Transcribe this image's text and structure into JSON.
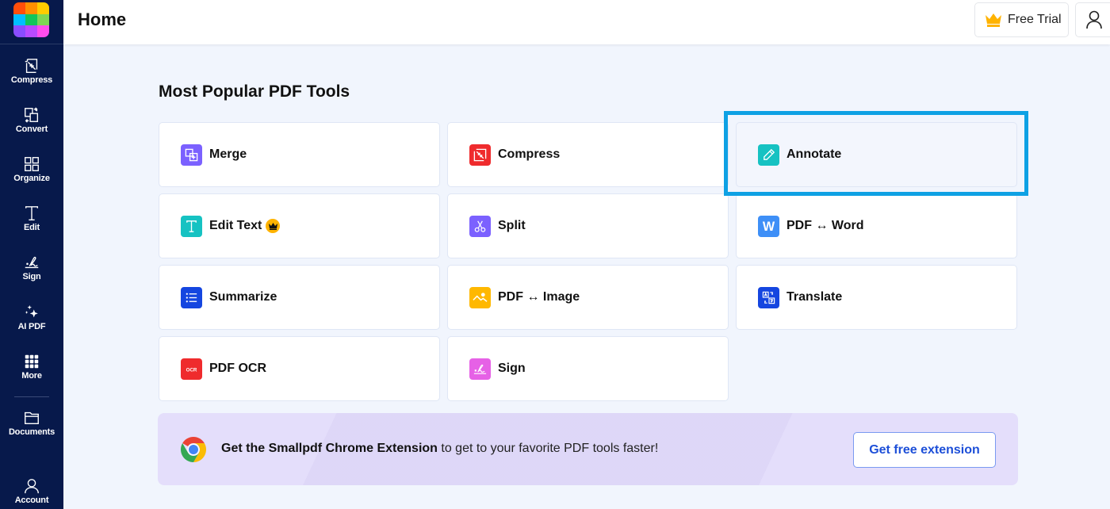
{
  "app": {
    "logo_colors": [
      "#ff4e0a",
      "#ff8f00",
      "#ffcc00",
      "#00bfff",
      "#12c65a",
      "#7fd655",
      "#8a4dff",
      "#b94bff",
      "#ff4ded"
    ]
  },
  "sidebar": {
    "items": [
      {
        "label": "Compress",
        "icon": "compress-icon"
      },
      {
        "label": "Convert",
        "icon": "convert-icon"
      },
      {
        "label": "Organize",
        "icon": "organize-icon"
      },
      {
        "label": "Edit",
        "icon": "edit-text-icon"
      },
      {
        "label": "Sign",
        "icon": "signature-icon"
      },
      {
        "label": "AI PDF",
        "icon": "sparkle-icon"
      },
      {
        "label": "More",
        "icon": "grid-dots-icon"
      },
      {
        "label": "Documents",
        "icon": "folder-icon"
      },
      {
        "label": "Account",
        "icon": "user-icon"
      }
    ]
  },
  "header": {
    "title": "Home",
    "free_trial_label": "Free Trial",
    "accent_color": "#ffb300"
  },
  "main": {
    "section_title": "Most Popular PDF Tools",
    "highlighted_tool": "Annotate",
    "highlight_color": "#0ea1e4",
    "tools": [
      {
        "label": "Merge",
        "icon": "merge-icon",
        "color": "#7b61ff",
        "premium": false
      },
      {
        "label": "Compress",
        "icon": "compress-icon",
        "color": "#ef2b2d",
        "premium": false
      },
      {
        "label": "Annotate",
        "icon": "pencil-icon",
        "color": "#16c2c2",
        "premium": false
      },
      {
        "label": "Edit Text",
        "icon": "text-icon",
        "color": "#16c2c2",
        "premium": true
      },
      {
        "label": "Split",
        "icon": "scissors-icon",
        "color": "#7b61ff",
        "premium": false
      },
      {
        "label": "PDF ↔ Word",
        "icon": "word-icon",
        "color": "#3e8ff7",
        "premium": false
      },
      {
        "label": "Summarize",
        "icon": "list-icon",
        "color": "#1546e0",
        "premium": false
      },
      {
        "label": "PDF ↔ Image",
        "icon": "image-icon",
        "color": "#ffb800",
        "premium": false
      },
      {
        "label": "Translate",
        "icon": "translate-icon",
        "color": "#1546e0",
        "premium": false
      },
      {
        "label": "PDF OCR",
        "icon": "ocr-icon",
        "color": "#ef2b2d",
        "premium": false,
        "icon_text": "OCR"
      },
      {
        "label": "Sign",
        "icon": "signature-icon",
        "color": "#e661e6",
        "premium": false
      }
    ],
    "banner": {
      "bold_text": "Get the Smallpdf Chrome Extension",
      "text": " to get to your favorite PDF tools faster!",
      "button_label": "Get free extension",
      "button_color": "#1d4fd8"
    },
    "word_icon_letter": "W"
  }
}
